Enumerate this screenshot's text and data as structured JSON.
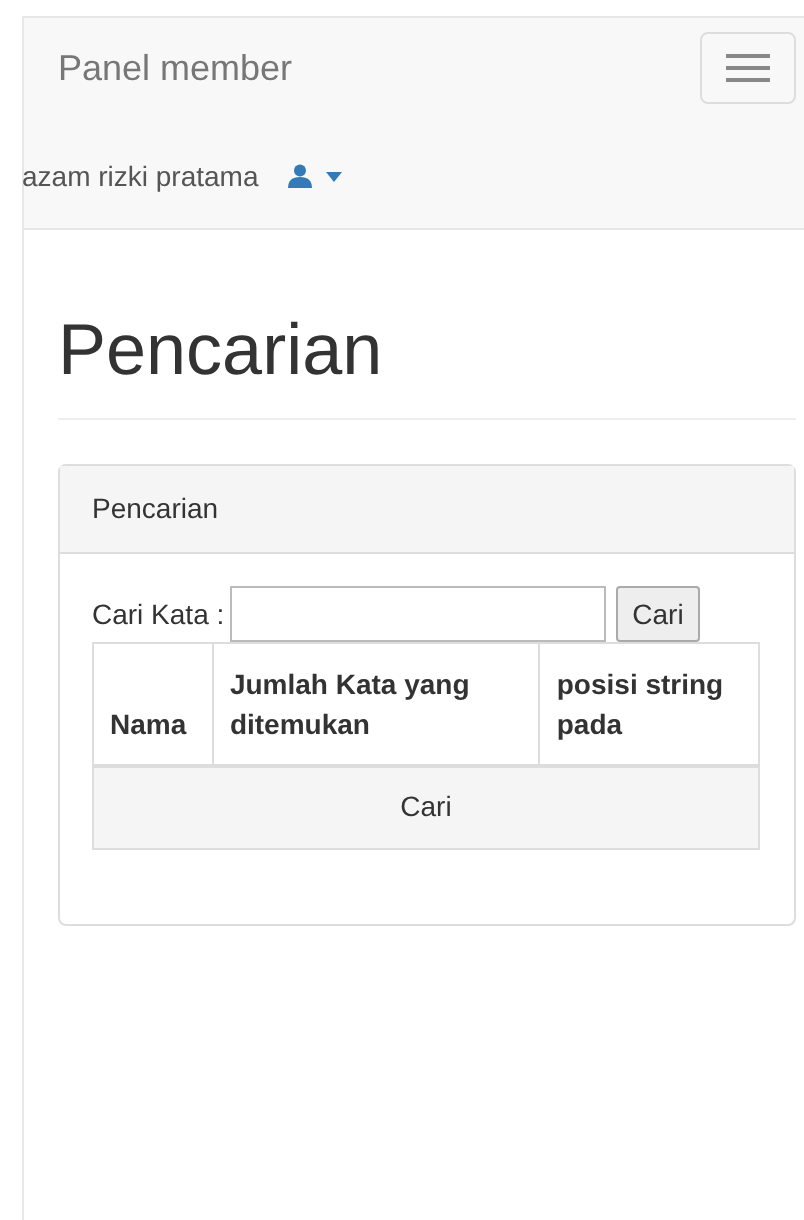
{
  "navbar": {
    "brand": "Panel member",
    "user": "azam rizki pratama"
  },
  "page": {
    "title": "Pencarian"
  },
  "panel": {
    "heading": "Pencarian",
    "search_label": "Cari Kata :",
    "search_button": "Cari",
    "table": {
      "columns": [
        "Nama",
        "Jumlah Kata yang ditemukan",
        "posisi string pada"
      ],
      "footer_button": "Cari"
    }
  }
}
